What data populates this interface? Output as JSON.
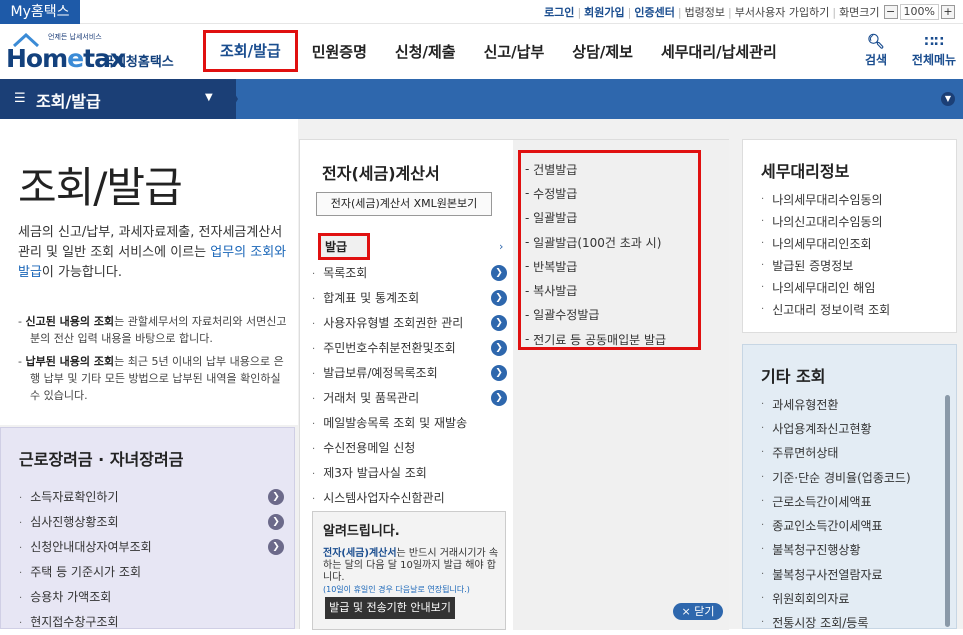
{
  "topbar": {
    "my": "My홈택스",
    "login": "로그인",
    "join": "회원가입",
    "cert": "인증센터",
    "law": "법령정보",
    "dept_join": "부서사용자 가입하기",
    "screen_size": "화면크기",
    "zoom": "100%",
    "minus": "−",
    "plus": "+"
  },
  "logo": {
    "slogan": "언제든 납세서비스",
    "home1": "Hom",
    "home2": "e",
    "home3": "tax",
    "korean": "국세청홈택스"
  },
  "gnav": [
    "조회/발급",
    "민원증명",
    "신청/제출",
    "신고/납부",
    "상담/제보",
    "세무대리/납세관리"
  ],
  "header_icons": {
    "search": "검색",
    "all_menu": "전체메뉴"
  },
  "navbar": {
    "current": "조회/발급"
  },
  "intro": {
    "title": "조회/발급",
    "desc_pre": "세금의 신고/납부, 과세자료제출, 전자세금계산서 관리 및 일반 조회 서비스에 이르는 ",
    "desc_hl": "업무의 조회와 발급",
    "desc_post": "이 가능합니다.",
    "note1_bold": "신고된 내용의 조회",
    "note1_text": "는 관할세무서의 자료처리와 서면신고분의 전산 입력 내용을 바탕으로 합니다.",
    "note2_bold": "납부된 내용의 조회",
    "note2_text": "는 최근 5년 이내의 납부 내용으로 은행 납부 및 기타 모든 방법으로 납부된 내역을 확인하실 수 있습니다."
  },
  "reward": {
    "title": "근로장려금 · 자녀장려금",
    "items": [
      "소득자료확인하기",
      "심사진행상황조회",
      "신청안내대상자여부조회",
      "주택 등 기준시가 조회",
      "승용차 가액조회",
      "현지접수창구조회"
    ]
  },
  "tax_invoice": {
    "title": "전자(세금)계산서",
    "xml_button": "전자(세금)계산서 XML원본보기",
    "menu": [
      {
        "label": "발급"
      },
      {
        "label": "목록조회"
      },
      {
        "label": "합계표 및 통계조회"
      },
      {
        "label": "사용자유형별 조회권한 관리"
      },
      {
        "label": "주민번호수취분전환및조회"
      },
      {
        "label": "발급보류/예정목록조회"
      },
      {
        "label": "거래처 및 품목관리"
      },
      {
        "label": "메일발송목록 조회 및 재발송"
      },
      {
        "label": "수신전용메일 신청"
      },
      {
        "label": "제3자 발급사실 조회"
      },
      {
        "label": "시스템사업자수신함관리"
      }
    ],
    "sub": [
      "건별발급",
      "수정발급",
      "일괄발급",
      "일괄발급(100건 초과 시)",
      "반복발급",
      "복사발급",
      "일괄수정발급",
      "전기료 등 공동매입분 발급"
    ]
  },
  "notice": {
    "title": "알려드립니다.",
    "t1": "전자(세금)계산서",
    "t2": "는 반드시 거래시기가 속하는 달의 다음 달 10일까지 발급",
    "t3": "해야 합니다.",
    "t4": "(10일이 휴일인 경우 다음날로 연장됩니다.)",
    "button": "발급 및 전송기한 안내보기"
  },
  "close_label": "× 닫기",
  "agent_info": {
    "title": "세무대리정보",
    "items": [
      "나의세무대리수임동의",
      "나의신고대리수임동의",
      "나의세무대리인조회",
      "발급된 증명정보",
      "나의세무대리인 해임",
      "신고대리 정보이력 조회"
    ]
  },
  "other": {
    "title": "기타 조회",
    "items": [
      "과세유형전환",
      "사업용계좌신고현황",
      "주류면허상태",
      "기준·단순 경비율(업종코드)",
      "근로소득간이세액표",
      "종교인소득간이세액표",
      "불복청구진행상황",
      "불복청구사전열람자료",
      "위원회회의자료",
      "전통시장 조회/등록"
    ]
  }
}
